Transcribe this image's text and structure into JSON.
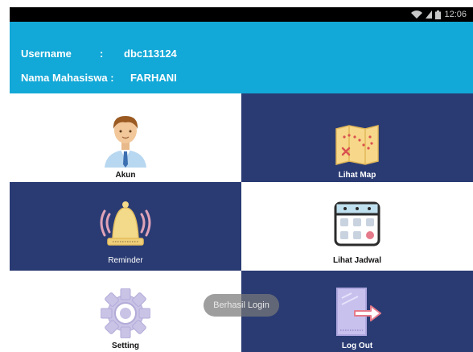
{
  "status_bar": {
    "time": "12:06"
  },
  "header": {
    "username_label": "Username",
    "username_sep": ":",
    "username_value": "dbc113124",
    "name_label": "Nama Mahasiswa :",
    "name_value": "FARHANI"
  },
  "menu": {
    "account_label": "Akun",
    "map_label": "Lihat Map",
    "reminder_label": "Reminder",
    "schedule_label": "Lihat Jadwal",
    "setting_label": "Setting",
    "logout_label": "Log Out"
  },
  "toast": {
    "message": "Berhasil Login"
  },
  "colors": {
    "header": "#12a8d7",
    "navy": "#2a3b73",
    "white": "#ffffff"
  }
}
